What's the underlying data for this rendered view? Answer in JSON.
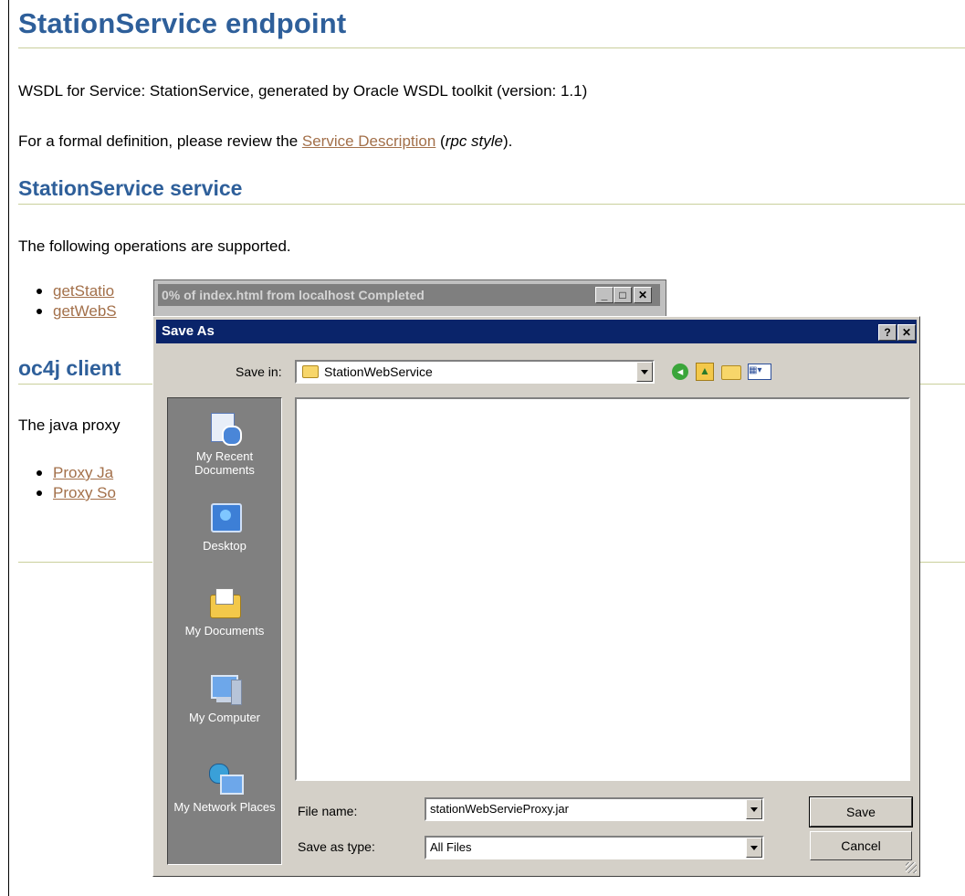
{
  "page": {
    "title": "StationService endpoint",
    "wsdl_line": "WSDL for Service: StationService, generated by Oracle WSDL toolkit (version: 1.1)",
    "formal_prefix": "For a formal definition, please review the ",
    "formal_link": "Service Description",
    "formal_open": " (",
    "formal_style": "rpc style",
    "formal_close": ").",
    "section_service": "StationService service",
    "ops_intro": "The following operations are supported.",
    "operations": [
      "getStatio",
      "getWebS"
    ],
    "section_client": "oc4j client",
    "proxy_intro": "The java proxy",
    "proxy_links": [
      "Proxy Ja",
      "Proxy So"
    ]
  },
  "progress_window": {
    "title": "0% of index.html from localhost Completed"
  },
  "dialog": {
    "title": "Save As",
    "save_in_label": "Save in:",
    "save_in_value": "StationWebService",
    "places": [
      {
        "label": "My Recent Documents",
        "icon": "recent-documents-icon"
      },
      {
        "label": "Desktop",
        "icon": "desktop-icon"
      },
      {
        "label": "My Documents",
        "icon": "my-documents-icon"
      },
      {
        "label": "My Computer",
        "icon": "my-computer-icon"
      },
      {
        "label": "My Network Places",
        "icon": "network-places-icon"
      }
    ],
    "file_name_label": "File name:",
    "file_name_value": "stationWebServieProxy.jar",
    "save_type_label": "Save as type:",
    "save_type_value": "All Files",
    "save_button": "Save",
    "cancel_button": "Cancel",
    "help_button": "?",
    "close_button": "✕"
  },
  "colors": {
    "heading": "#2e5f9a",
    "link": "#a3704a",
    "dialog_title_bar": "#0a246a",
    "dialog_bg": "#d4d0c8"
  }
}
